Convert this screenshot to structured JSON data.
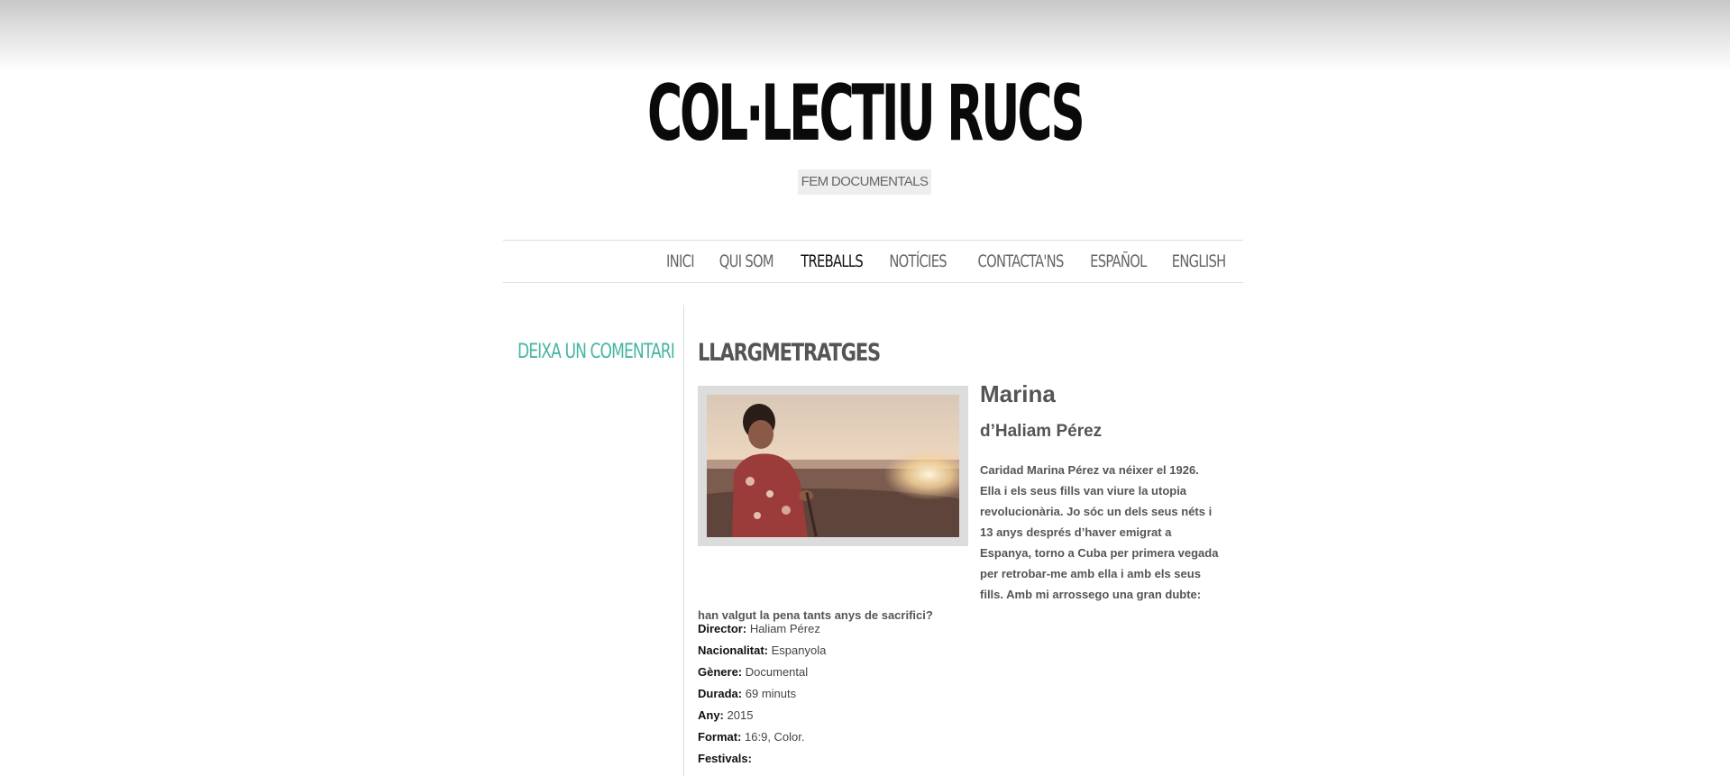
{
  "site": {
    "title": "COL·LECTIU RUCS",
    "tagline": "FEM DOCUMENTALS"
  },
  "nav": {
    "items": [
      {
        "label": "INICI",
        "active": false
      },
      {
        "label": "QUI SOM",
        "active": false
      },
      {
        "label": "TREBALLS",
        "active": true
      },
      {
        "label": "NOTÍCIES",
        "active": false
      },
      {
        "label": "CONTACTA'NS",
        "active": false
      },
      {
        "label": "ESPAÑOL",
        "active": false
      },
      {
        "label": "ENGLISH",
        "active": false
      }
    ]
  },
  "sidebar": {
    "comment_link": "DEIXA UN COMENTARI"
  },
  "main": {
    "section_title": "LLARGMETRATGES",
    "film": {
      "title": "Marina",
      "subtitle": "d’Haliam Pérez",
      "synopsis": "Caridad Marina Pérez va néixer el 1926. Ella i els seus fills van viure la utopia revolucionària. Jo sóc un dels seus néts i 13 anys després d’haver emigrat a Espanya, torno a Cuba per primera vegada per retrobar-me amb ella i amb els seus fills. Amb mi arrossego una gran dubte: han valgut la pena tants anys de sacrifici?",
      "details": [
        {
          "label": "Director:",
          "value": "Haliam Pérez"
        },
        {
          "label": "Nacionalitat:",
          "value": "Espanyola"
        },
        {
          "label": "Gènere:",
          "value": "Documental"
        },
        {
          "label": "Durada:",
          "value": "69 minuts"
        },
        {
          "label": "Any:",
          "value": "2015"
        },
        {
          "label": "Format:",
          "value": "16:9, Color."
        },
        {
          "label": "Festivals:",
          "value": ""
        }
      ]
    }
  },
  "colors": {
    "accent": "#47b5a2",
    "nav_text": "#666666",
    "nav_active": "#111111"
  }
}
